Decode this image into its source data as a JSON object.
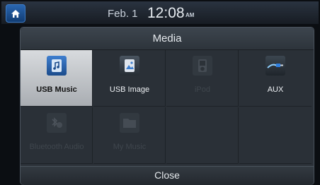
{
  "status": {
    "date": "Feb.  1",
    "time": "12:08",
    "ampm": "AM"
  },
  "panel": {
    "title": "Media",
    "close_label": "Close",
    "items": [
      {
        "label": "USB Music",
        "icon": "usb-music-icon",
        "state": "selected"
      },
      {
        "label": "USB Image",
        "icon": "usb-image-icon",
        "state": "enabled"
      },
      {
        "label": "iPod",
        "icon": "ipod-icon",
        "state": "disabled"
      },
      {
        "label": "AUX",
        "icon": "aux-cable-icon",
        "state": "enabled"
      },
      {
        "label": "Bluetooth Audio",
        "icon": "bluetooth-audio-icon",
        "state": "disabled"
      },
      {
        "label": "My Music",
        "icon": "my-music-folder-icon",
        "state": "disabled"
      }
    ]
  },
  "colors": {
    "home_button": "#1f5aa5",
    "panel_bg": "#2a3037",
    "selected_tile": "#c9ccd0"
  }
}
